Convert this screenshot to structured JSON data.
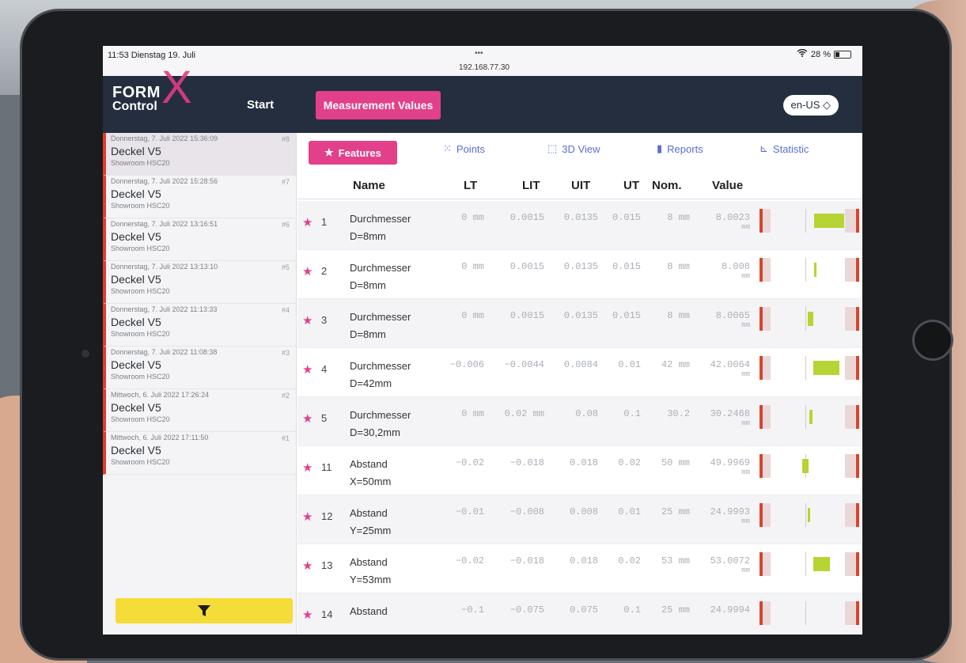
{
  "status": {
    "time_date": "11:53  Dienstag 19. Juli",
    "dots": "•••",
    "ip": "192.168.77.30",
    "battery": "28 %"
  },
  "app": {
    "logo_line1": "FORM",
    "logo_line2": "Control",
    "logo_x": "X",
    "nav_start": "Start",
    "nav_measurement": "Measurement Values",
    "language": "en-US ◇"
  },
  "sidebar": {
    "items": [
      {
        "date": "Donnerstag, 7. Juli 2022 15:36:09",
        "num": "#8",
        "title": "Deckel V5",
        "sub": "Showroom HSC20"
      },
      {
        "date": "Donnerstag, 7. Juli 2022 15:28:56",
        "num": "#7",
        "title": "Deckel V5",
        "sub": "Showroom HSC20"
      },
      {
        "date": "Donnerstag, 7. Juli 2022 13:16:51",
        "num": "#6",
        "title": "Deckel V5",
        "sub": "Showroom HSC20"
      },
      {
        "date": "Donnerstag, 7. Juli 2022 13:13:10",
        "num": "#5",
        "title": "Deckel V5",
        "sub": "Showroom HSC20"
      },
      {
        "date": "Donnerstag, 7. Juli 2022 11:13:33",
        "num": "#4",
        "title": "Deckel V5",
        "sub": "Showroom HSC20"
      },
      {
        "date": "Donnerstag, 7. Juli 2022 11:08:38",
        "num": "#3",
        "title": "Deckel V5",
        "sub": "Showroom HSC20"
      },
      {
        "date": "Mittwoch, 6. Juli 2022 17:26:24",
        "num": "#2",
        "title": "Deckel V5",
        "sub": "Showroom HSC20"
      },
      {
        "date": "Mittwoch, 6. Juli 2022 17:11:50",
        "num": "#1",
        "title": "Deckel V5",
        "sub": "Showroom HSC20"
      }
    ],
    "filter_icon": "filter-icon"
  },
  "tabs": {
    "features": "Features",
    "points": "Points",
    "view3d": "3D View",
    "reports": "Reports",
    "statistic": "Statistic"
  },
  "table": {
    "headers": {
      "name": "Name",
      "lt": "LT",
      "lit": "LIT",
      "uit": "UIT",
      "ut": "UT",
      "nom": "Nom.",
      "value": "Value"
    },
    "rows": [
      {
        "idx": "1",
        "name1": "Durchmesser",
        "name2": "D=8mm",
        "lt": "0 mm",
        "lit": "0.0015",
        "uit": "0.0135",
        "ut": "0.015",
        "nom": "8 mm",
        "value": "8.0023",
        "unit": "mm",
        "fill_pos": 0.55,
        "fill_w": 0.32
      },
      {
        "idx": "2",
        "name1": "Durchmesser",
        "name2": "D=8mm",
        "lt": "0 mm",
        "lit": "0.0015",
        "uit": "0.0135",
        "ut": "0.015",
        "nom": "8 mm",
        "value": "8.008",
        "unit": "mm",
        "fill_pos": 0.55,
        "fill_w": 0.03
      },
      {
        "idx": "3",
        "name1": "Durchmesser",
        "name2": "D=8mm",
        "lt": "0 mm",
        "lit": "0.0015",
        "uit": "0.0135",
        "ut": "0.015",
        "nom": "8 mm",
        "value": "8.0065",
        "unit": "mm",
        "fill_pos": 0.48,
        "fill_w": 0.06
      },
      {
        "idx": "4",
        "name1": "Durchmesser",
        "name2": "D=42mm",
        "lt": "−0.006",
        "lit": "−0.0044",
        "uit": "0.0084",
        "ut": "0.01",
        "nom": "42 mm",
        "value": "42.0064",
        "unit": "mm",
        "fill_pos": 0.54,
        "fill_w": 0.28
      },
      {
        "idx": "5",
        "name1": "Durchmesser",
        "name2": "D=30,2mm",
        "lt": "0 mm",
        "lit": "0.02 mm",
        "uit": "0.08",
        "ut": "0.1",
        "nom": "30.2",
        "value": "30.2468",
        "unit": "mm",
        "fill_pos": 0.5,
        "fill_w": 0.03
      },
      {
        "idx": "11",
        "name1": "Abstand",
        "name2": "X=50mm",
        "lt": "−0.02",
        "lit": "−0.018",
        "uit": "0.018",
        "ut": "0.02",
        "nom": "50 mm",
        "value": "49.9969",
        "unit": "mm",
        "fill_pos": 0.42,
        "fill_w": 0.07
      },
      {
        "idx": "12",
        "name1": "Abstand",
        "name2": "Y=25mm",
        "lt": "−0.01",
        "lit": "−0.008",
        "uit": "0.008",
        "ut": "0.01",
        "nom": "25 mm",
        "value": "24.9993",
        "unit": "mm",
        "fill_pos": 0.48,
        "fill_w": 0.03
      },
      {
        "idx": "13",
        "name1": "Abstand",
        "name2": "Y=53mm",
        "lt": "−0.02",
        "lit": "−0.018",
        "uit": "0.018",
        "ut": "0.02",
        "nom": "53 mm",
        "value": "53.0072",
        "unit": "mm",
        "fill_pos": 0.54,
        "fill_w": 0.18
      },
      {
        "idx": "14",
        "name1": "Abstand",
        "name2": "",
        "lt": "−0.1",
        "lit": "−0.075",
        "uit": "0.075",
        "ut": "0.1",
        "nom": "25 mm",
        "value": "24.9994",
        "unit": "",
        "fill_pos": 0.5,
        "fill_w": 0.0
      }
    ]
  },
  "colors": {
    "accent": "#e2408a",
    "header_bg": "#242e3e",
    "ok_fill": "#b6d433",
    "limit": "#d6452c",
    "filter": "#f5dc38"
  }
}
